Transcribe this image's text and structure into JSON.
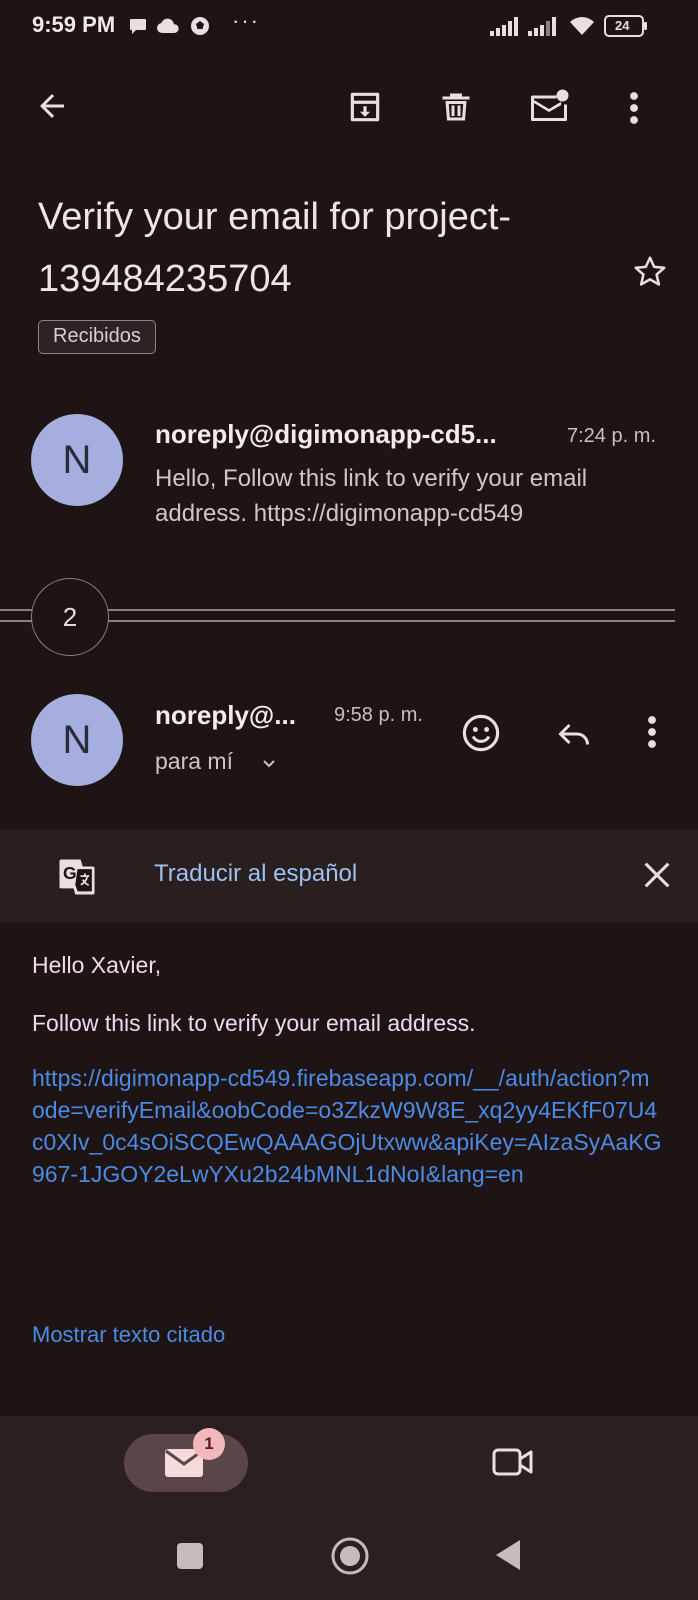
{
  "status_bar": {
    "time": "9:59 PM",
    "dots": "···",
    "battery": "24",
    "icons": [
      "chat-bubble-icon",
      "cloud-icon",
      "soccer-ball-icon",
      "signal-icon",
      "signal-icon",
      "wifi-icon",
      "battery-icon"
    ]
  },
  "toolbar": {
    "icons": [
      "back-arrow-icon",
      "archive-icon",
      "delete-icon",
      "mark-unread-icon",
      "more-vert-icon"
    ]
  },
  "email": {
    "subject": "Verify your email for project-139484235704",
    "label": "Recibidos",
    "first_message": {
      "avatar_letter": "N",
      "sender": "noreply@digimonapp-cd5...",
      "time": "7:24 p. m.",
      "snippet": "Hello, Follow this link to verify your email address. https://digimonapp-cd549"
    },
    "collapsed_count": "2",
    "second_message": {
      "avatar_letter": "N",
      "sender": "noreply@...",
      "time": "9:58 p. m.",
      "recipient": "para mí"
    },
    "translate_label": "Traducir al español",
    "body": {
      "greeting": "Hello Xavier,",
      "text": "Follow this link to verify your email address.",
      "link": "https://digimonapp-cd549.firebaseapp.com/__/auth/action?mode=verifyEmail&oobCode=o3ZkzW9W8E_xq2yy4EKfF07U4c0XIv_0c4sOiSCQEwQAAAGOjUtxww&apiKey=AIzaSyAaKG967-1JGOY2eLwYXu2b24bMNL1dNoI&lang=en",
      "show_quoted": "Mostrar texto citado"
    }
  },
  "bottom_nav": {
    "mail_badge": "1",
    "icons": [
      "mail-icon",
      "video-camera-icon"
    ]
  },
  "system_nav": {
    "icons": [
      "recents-square-icon",
      "home-circle-icon",
      "back-triangle-icon"
    ]
  },
  "colors": {
    "background": "#1e1414",
    "avatar": "#a6aee0",
    "link": "#4b8be6",
    "translate_link": "#9ec0f2",
    "body_text": "#f0d8ee"
  }
}
